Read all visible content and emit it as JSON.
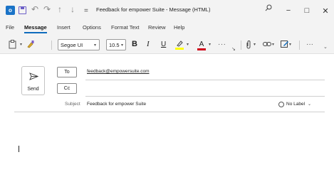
{
  "titlebar": {
    "window_title": "Feedback for empower Suite  -  Message (HTML)",
    "app_icon_letter": "o",
    "minimize": "−",
    "maximize": "□",
    "close": "✕"
  },
  "quick_access": {
    "undo": "↶",
    "redo": "↷",
    "up": "↑",
    "down": "↓",
    "customize": "="
  },
  "menu_tabs": [
    {
      "label": "File"
    },
    {
      "label": "Message",
      "active": true
    },
    {
      "label": "Insert"
    },
    {
      "label": "Options"
    },
    {
      "label": "Format Text"
    },
    {
      "label": "Review"
    },
    {
      "label": "Help"
    }
  ],
  "ribbon": {
    "font_name": "Segoe UI",
    "font_size": "10.5",
    "bold": "B",
    "italic": "I",
    "underline": "U",
    "font_color_letter": "A",
    "more": "···",
    "highlight_color": "#ffff00",
    "font_color": "#d0021b"
  },
  "compose": {
    "send_label": "Send",
    "to_label": "To",
    "cc_label": "Cc",
    "to_value": "feedback@empowersuite.com",
    "cc_value": "",
    "subject_label": "Subject",
    "subject_value": "Feedback for empower Suite",
    "sensitivity_label": "No Label"
  },
  "colors": {
    "accent": "#0f6cbd",
    "chrome_bg": "#f3f3f3"
  }
}
